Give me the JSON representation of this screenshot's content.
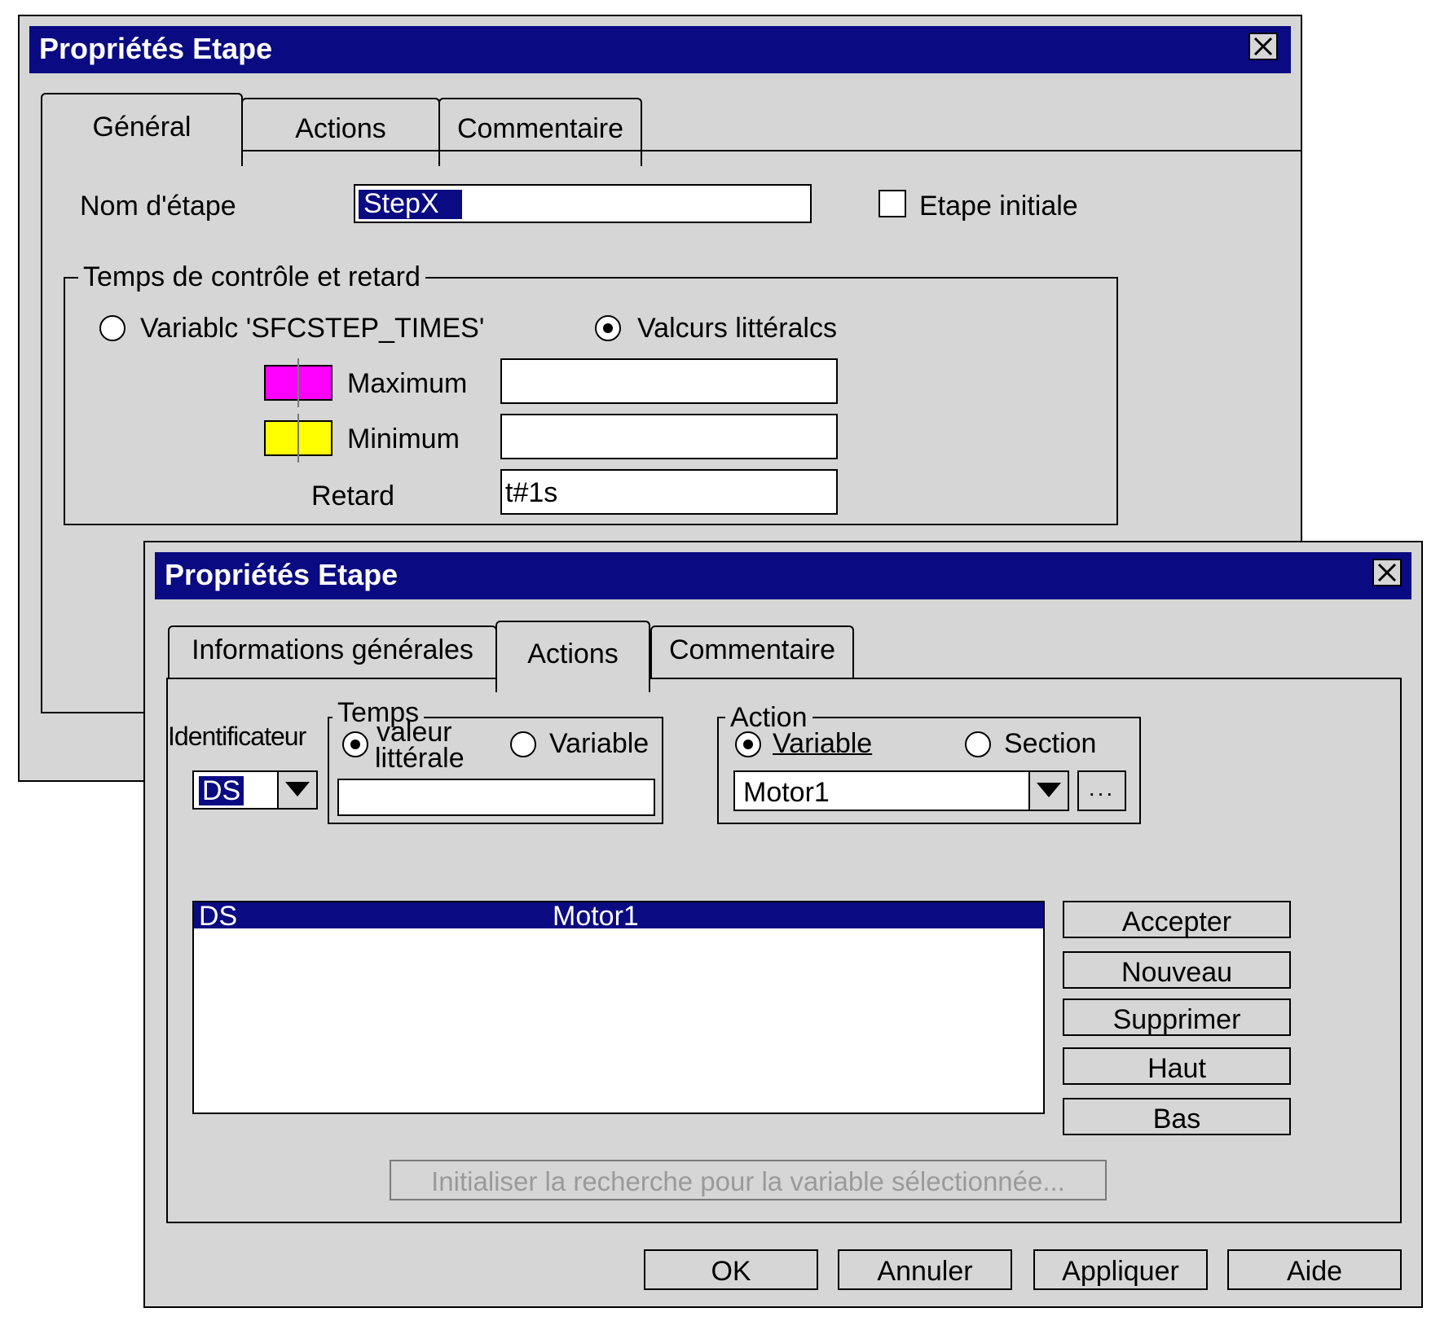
{
  "back_dialog": {
    "title": "Propriétés Etape",
    "tabs": [
      "Général",
      "Actions",
      "Commentaire"
    ],
    "step_name_label": "Nom d'étape",
    "step_name_value": "StepX",
    "initial_step_label": "Etape initiale",
    "initial_step_checked": false,
    "group_title": "Temps de contrôle et retard",
    "radio_variable_label": "Variablc 'SFCSTEP_TIMES'",
    "radio_literal_label": "Valcurs littéralcs",
    "max_label": "Maximum",
    "min_label": "Minimum",
    "delay_label": "Retard",
    "max_value": "",
    "min_value": "",
    "delay_value": "t#1s",
    "max_color": "#ff00ff",
    "min_color": "#ffff00"
  },
  "front_dialog": {
    "title": "Propriétés Etape",
    "tabs": [
      "Informations générales",
      "Actions",
      "Commentaire"
    ],
    "identifier_label": "Identificateur",
    "identifier_value": "DS",
    "time_group_title": "Temps",
    "time_literal_line1": "valeur",
    "time_literal_line2": "littérale",
    "time_variable_label": "Variable",
    "time_value": "",
    "action_group_title": "Action",
    "action_variable_label": "Variable",
    "action_section_label": "Section",
    "action_value": "Motor1",
    "browse_label": "...",
    "list_rows": [
      {
        "qualifier": "DS",
        "action": "Motor1"
      }
    ],
    "side_buttons": [
      "Accepter",
      "Nouveau",
      "Supprimer",
      "Haut",
      "Bas"
    ],
    "search_button": "Initialiser la recherche pour la variable sélectionnée...",
    "footer_buttons": [
      "OK",
      "Annuler",
      "Appliquer",
      "Aide"
    ],
    "selection_color": "#0a0a82"
  }
}
